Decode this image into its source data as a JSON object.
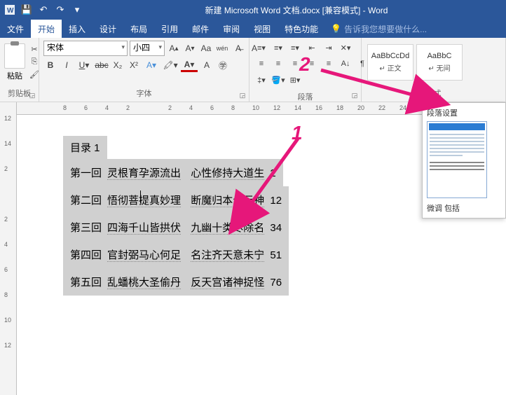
{
  "title": "新建 Microsoft Word 文档.docx [兼容模式] - Word",
  "tabs": [
    "文件",
    "开始",
    "插入",
    "设计",
    "布局",
    "引用",
    "邮件",
    "审阅",
    "视图",
    "特色功能"
  ],
  "tellme": "告诉我您想要做什么...",
  "groups": {
    "clipboard": "剪贴板",
    "font": "字体",
    "paragraph": "段落",
    "styles": "样式"
  },
  "paste": "粘贴",
  "font": {
    "name": "宋体",
    "size": "小四"
  },
  "styles": [
    {
      "sample": "AaBbCcDd",
      "name": "↵ 正文"
    },
    {
      "sample": "AaBbC",
      "name": "↵ 无间"
    }
  ],
  "hruler": [
    8,
    6,
    4,
    2,
    "",
    2,
    4,
    6,
    8,
    10,
    12,
    14,
    16,
    18,
    20,
    22,
    24,
    26
  ],
  "vruler": [
    12,
    14,
    2,
    "",
    2,
    4,
    6,
    8,
    10,
    12
  ],
  "toc": {
    "title": "目录 1",
    "lines": [
      {
        "ch": "第一回",
        "t1": "灵根育孕源流出",
        "t2": "心性修持大道生",
        "pg": "2"
      },
      {
        "ch": "第二回",
        "t1": "悟彻菩提真妙理",
        "t2": "断魔归本合元神",
        "pg": "12"
      },
      {
        "ch": "第三回",
        "t1": "四海千山皆拱伏",
        "t2": "九幽十类尽除名",
        "pg": "34"
      },
      {
        "ch": "第四回",
        "t1": "官封弼马心何足",
        "t2": "名注齐天意未宁",
        "pg": "51"
      },
      {
        "ch": "第五回",
        "t1": "乱蟠桃大圣偷丹",
        "t2": "反天宫诸神捉怪",
        "pg": "76"
      }
    ]
  },
  "callout": {
    "title": "段落设置",
    "desc": "微调\n包括"
  },
  "annotations": {
    "n1": "1",
    "n2": "2"
  }
}
